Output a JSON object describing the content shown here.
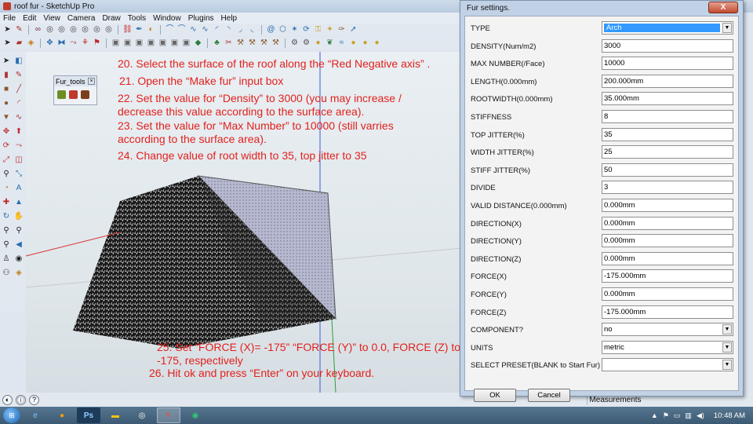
{
  "window": {
    "title": "roof fur - SketchUp Pro"
  },
  "menu": [
    "File",
    "Edit",
    "View",
    "Camera",
    "Draw",
    "Tools",
    "Window",
    "Plugins",
    "Help"
  ],
  "fur_tools": {
    "title": "Fur_tools"
  },
  "instructions": {
    "s20": "20. Select the surface of the roof along the “Red Negative axis” .",
    "s21": "21. Open the “Make fur” input box",
    "s22a": "22. Set the value for “Density” to 3000 (you may increase /",
    "s22b": "decrease this value according to the surface area).",
    "s23a": "23. Set the value for “Max Number” to 10000 (still varries",
    "s23b": "according to the surface area).",
    "s24": "24. Change value of root width to 35, top jitter to 35",
    "s25a": "25. Set “FORCE (X)= -175” “FORCE (Y)” to 0.0, FORCE (Z) to",
    "s25b": "-175, respectively",
    "s26": "26. Hit ok and press “Enter” on your keyboard."
  },
  "dialog": {
    "title": "Fur settings.",
    "close": "X",
    "fields": [
      {
        "label": "TYPE",
        "value": "Arch",
        "kind": "select-highlight"
      },
      {
        "label": "DENSITY(Num/m2)",
        "value": "3000",
        "kind": "input"
      },
      {
        "label": "MAX NUMBER(/Face)",
        "value": "10000",
        "kind": "input"
      },
      {
        "label": "LENGTH(0.000mm)",
        "value": "200.000mm",
        "kind": "input"
      },
      {
        "label": "ROOTWIDTH(0.000mm)",
        "value": "35.000mm",
        "kind": "input"
      },
      {
        "label": "STIFFNESS",
        "value": "8",
        "kind": "input"
      },
      {
        "label": "TOP JITTER(%)",
        "value": "35",
        "kind": "input"
      },
      {
        "label": "WIDTH JITTER(%)",
        "value": "25",
        "kind": "input"
      },
      {
        "label": "STIFF JITTER(%)",
        "value": "50",
        "kind": "input"
      },
      {
        "label": "DIVIDE",
        "value": "3",
        "kind": "input"
      },
      {
        "label": "VALID DISTANCE(0.000mm)",
        "value": "0.000mm",
        "kind": "input"
      },
      {
        "label": "DIRECTION(X)",
        "value": "0.000mm",
        "kind": "input"
      },
      {
        "label": "DIRECTION(Y)",
        "value": "0.000mm",
        "kind": "input"
      },
      {
        "label": "DIRECTION(Z)",
        "value": "0.000mm",
        "kind": "input"
      },
      {
        "label": "FORCE(X)",
        "value": "-175.000mm",
        "kind": "input"
      },
      {
        "label": "FORCE(Y)",
        "value": "0.000mm",
        "kind": "input"
      },
      {
        "label": "FORCE(Z)",
        "value": "-175.000mm",
        "kind": "input"
      },
      {
        "label": "COMPONENT?",
        "value": "no",
        "kind": "select"
      },
      {
        "label": "UNITS",
        "value": "metric",
        "kind": "select"
      },
      {
        "label": "SELECT PRESET(BLANK to Start Fur)",
        "value": "",
        "kind": "select"
      }
    ],
    "ok": "OK",
    "cancel": "Cancel"
  },
  "statusbar": {
    "measurements_label": "Measurements"
  },
  "taskbar": {
    "clock": "10:48 AM",
    "ps_label": "Ps"
  },
  "colors": {
    "instruction_text": "#e3211d",
    "select_highlight": "#3399ff",
    "axis_green": "#2a9d3a",
    "axis_blue": "#3a5bd9",
    "axis_red": "#d83030"
  }
}
